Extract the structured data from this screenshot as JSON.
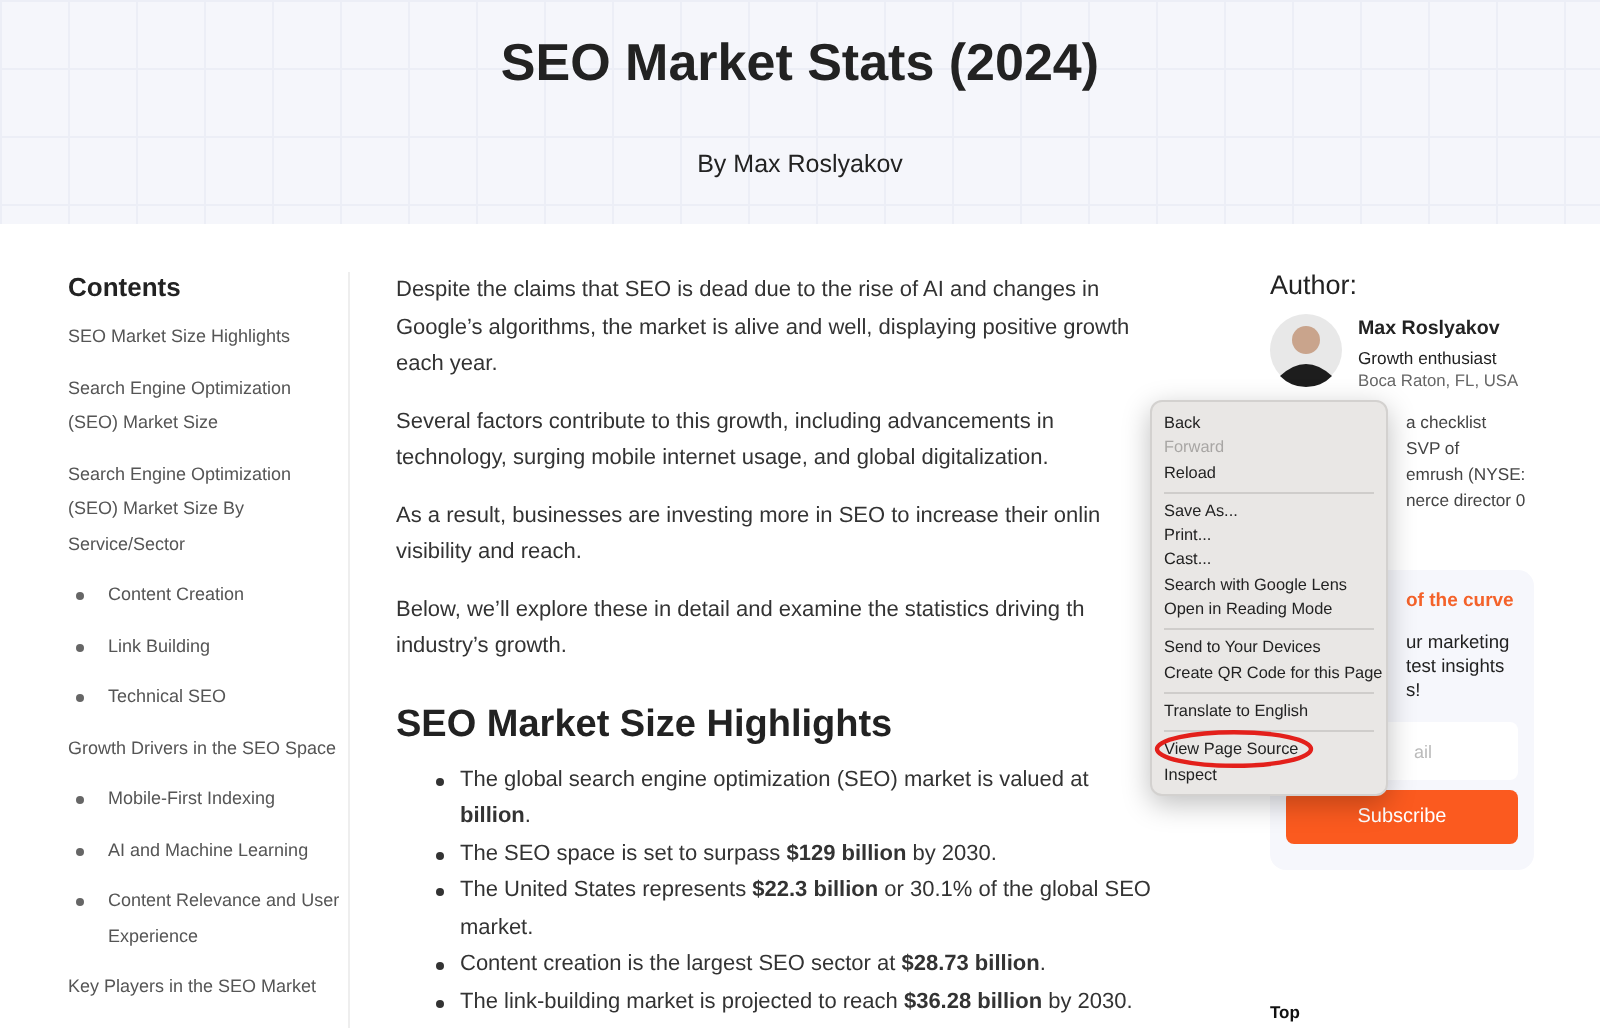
{
  "hero": {
    "title": "SEO Market Stats (2024)",
    "byline": "By Max Roslyakov"
  },
  "toc": {
    "heading": "Contents",
    "items": [
      {
        "label": "SEO Market Size Highlights"
      },
      {
        "label": "Search Engine Optimization (SEO) Market Size"
      },
      {
        "label": "Search Engine Optimization (SEO) Market Size By Service/Sector",
        "children": [
          {
            "label": "Content Creation"
          },
          {
            "label": "Link Building"
          },
          {
            "label": "Technical SEO"
          }
        ]
      },
      {
        "label": "Growth Drivers in the SEO Space",
        "children": [
          {
            "label": "Mobile-First Indexing"
          },
          {
            "label": "AI and Machine Learning"
          },
          {
            "label": "Content Relevance and User Experience"
          }
        ]
      },
      {
        "label": "Key Players in the SEO Market"
      }
    ]
  },
  "article": {
    "paragraphs": [
      "Despite the claims that SEO is dead due to the rise of AI and changes in\nGoogle’s algorithms, the market is alive and well, displaying positive growth\neach year.",
      "Several factors contribute to this growth, including advancements in\ntechnology, surging mobile internet usage, and global digitalization.",
      "As a result, businesses are investing more in SEO to increase their onlin\nvisibility and reach.",
      "Below, we’ll explore these in detail and examine the statistics driving th\nindustry’s growth."
    ],
    "heading": "SEO Market Size Highlights",
    "bullets": [
      "The global search engine optimization (SEO) market is valued at\n**billion**.",
      "The SEO space is set to surpass **$129 billion** by 2030.",
      "The United States represents **$22.3 billion** or 30.1% of the global SEO\nmarket.",
      "Content creation is the largest SEO sector at **$28.73 billion**.",
      "The link-building market is projected to reach **$36.28 billion** by 2030."
    ]
  },
  "author": {
    "heading": "Author:",
    "name": "Max Roslyakov",
    "role": "Growth enthusiast",
    "location": "Boca Raton, FL, USA",
    "bio": "a checklist\nSVP of\nemrush (NYSE:\nnerce director 0"
  },
  "newsletter": {
    "heading": "of the curve",
    "text": "ur marketing\ntest insights\ns!",
    "email_placeholder": "ail",
    "button": "Subscribe"
  },
  "top_link": "Top",
  "context_menu": {
    "items": [
      {
        "kind": "item",
        "label": "Back",
        "disabled": false,
        "circled": false
      },
      {
        "kind": "item",
        "label": "Forward",
        "disabled": true,
        "circled": false
      },
      {
        "kind": "item",
        "label": "Reload",
        "disabled": false,
        "circled": false
      },
      {
        "kind": "separator"
      },
      {
        "kind": "item",
        "label": "Save As...",
        "disabled": false,
        "circled": false
      },
      {
        "kind": "item",
        "label": "Print...",
        "disabled": false,
        "circled": false
      },
      {
        "kind": "item",
        "label": "Cast...",
        "disabled": false,
        "circled": false
      },
      {
        "kind": "item",
        "label": "Search with Google Lens",
        "disabled": false,
        "circled": false
      },
      {
        "kind": "item",
        "label": "Open in Reading Mode",
        "disabled": false,
        "circled": false
      },
      {
        "kind": "separator"
      },
      {
        "kind": "item",
        "label": "Send to Your Devices",
        "disabled": false,
        "circled": false
      },
      {
        "kind": "item",
        "label": "Create QR Code for this Page",
        "disabled": false,
        "circled": false
      },
      {
        "kind": "separator"
      },
      {
        "kind": "item",
        "label": "Translate to English",
        "disabled": false,
        "circled": false
      },
      {
        "kind": "separator"
      },
      {
        "kind": "item",
        "label": "View Page Source",
        "disabled": false,
        "circled": true
      },
      {
        "kind": "item",
        "label": "Inspect",
        "disabled": false,
        "circled": false
      }
    ]
  }
}
